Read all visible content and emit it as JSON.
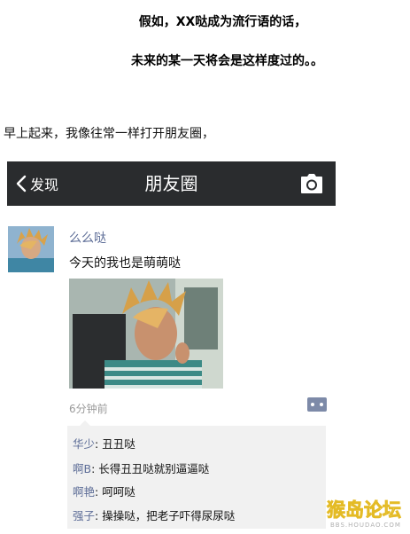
{
  "intro": {
    "line1": "假如，XX哒成为流行语的话，",
    "line2": "未来的某一天将会是这样度过的。。",
    "line3": "早上起来，我像往常一样打开朋友圈，"
  },
  "topbar": {
    "back_label": "发现",
    "title": "朋友圈",
    "icons": {
      "back": "chevron-left-icon",
      "camera": "camera-icon"
    }
  },
  "post": {
    "author": "么么哒",
    "text": "今天的我也是萌萌哒",
    "time": "6分钟前"
  },
  "comments": [
    {
      "name": "华少",
      "sep": ": ",
      "text": "丑丑哒"
    },
    {
      "name": "啊B",
      "sep": ": ",
      "text": "长得丑丑哒就别逼逼哒"
    },
    {
      "name": "啊艳",
      "sep": ": ",
      "text": "呵呵哒"
    },
    {
      "name": "强子",
      "sep": ": ",
      "text": "操操哒，把老子吓得尿尿哒"
    }
  ],
  "watermark": {
    "main": "猴岛论坛",
    "sub": "BBS.HOUDAO.COM"
  },
  "colors": {
    "topbar_bg": "#2a2c2e",
    "name_blue": "#5d6d97",
    "comment_bg": "#f1f1f1"
  }
}
